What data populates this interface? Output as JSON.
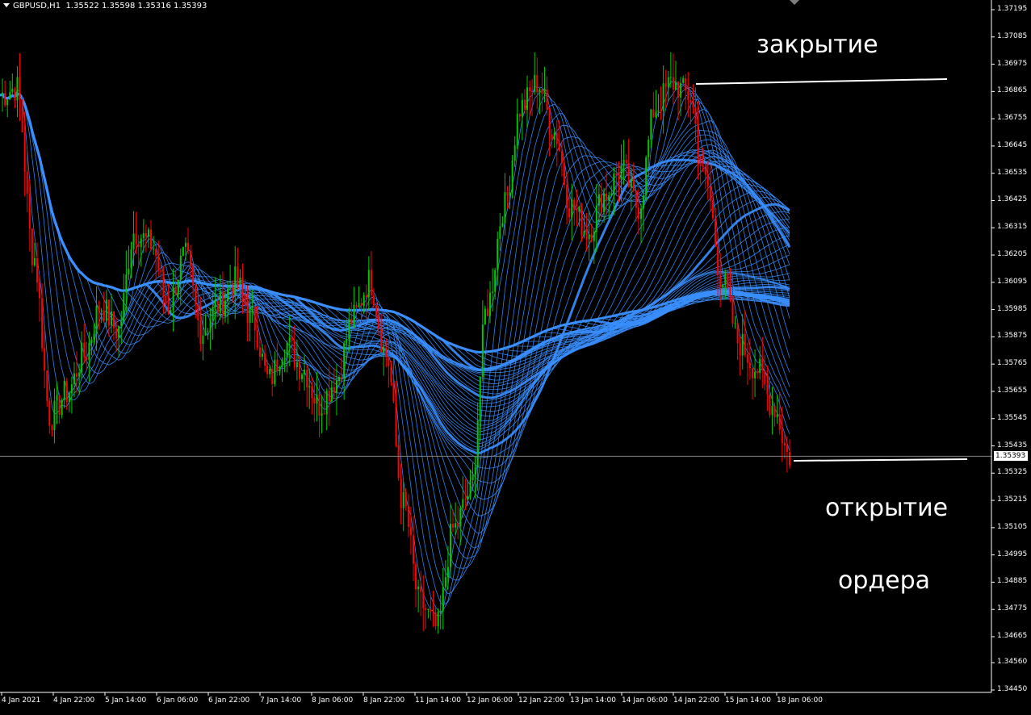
{
  "header": {
    "symbol": "GBPUSD,H1",
    "ohlc": "1.35522 1.35598 1.35316 1.35393"
  },
  "colors": {
    "background": "#000000",
    "ribbon": "#3a8fff",
    "bull_candle": "#00c800",
    "bear_candle": "#ff0000",
    "axis": "#ffffff"
  },
  "chart_data": {
    "type": "candlestick",
    "instrument": "GBPUSD",
    "timeframe": "H1",
    "price_axis": {
      "ticks": [
        "1.37195",
        "1.37085",
        "1.36975",
        "1.36865",
        "1.36755",
        "1.36645",
        "1.36535",
        "1.36425",
        "1.36315",
        "1.36205",
        "1.36095",
        "1.35985",
        "1.35875",
        "1.35765",
        "1.35655",
        "1.35545",
        "1.35435",
        "1.35325",
        "1.35215",
        "1.35105",
        "1.34995",
        "1.34885",
        "1.34775",
        "1.34665",
        "1.34560",
        "1.34450"
      ],
      "range": [
        1.3443,
        1.3724
      ]
    },
    "time_axis": {
      "ticks": [
        "4 Jan 2021",
        "4 Jan 22:00",
        "5 Jan 14:00",
        "6 Jan 06:00",
        "6 Jan 22:00",
        "7 Jan 14:00",
        "8 Jan 06:00",
        "8 Jan 22:00",
        "11 Jan 14:00",
        "12 Jan 06:00",
        "12 Jan 22:00",
        "13 Jan 14:00",
        "14 Jan 06:00",
        "14 Jan 22:00",
        "15 Jan 14:00",
        "18 Jan 06:00"
      ]
    },
    "current_price": "1.35393",
    "close_path": [
      1.3685,
      1.3688,
      1.362,
      1.3555,
      1.3565,
      1.358,
      1.36,
      1.359,
      1.363,
      1.3625,
      1.36,
      1.362,
      1.359,
      1.36,
      1.361,
      1.3595,
      1.357,
      1.3585,
      1.3575,
      1.356,
      1.357,
      1.3595,
      1.361,
      1.358,
      1.352,
      1.348,
      1.347,
      1.351,
      1.3525,
      1.36,
      1.364,
      1.368,
      1.369,
      1.367,
      1.364,
      1.363,
      1.3645,
      1.3655,
      1.364,
      1.368,
      1.369,
      1.3685,
      1.365,
      1.361,
      1.3585,
      1.3575,
      1.356,
      1.3539
    ],
    "annotations": [
      {
        "text": "закрытие"
      },
      {
        "text": "открытие"
      },
      {
        "text": "ордера"
      }
    ]
  }
}
